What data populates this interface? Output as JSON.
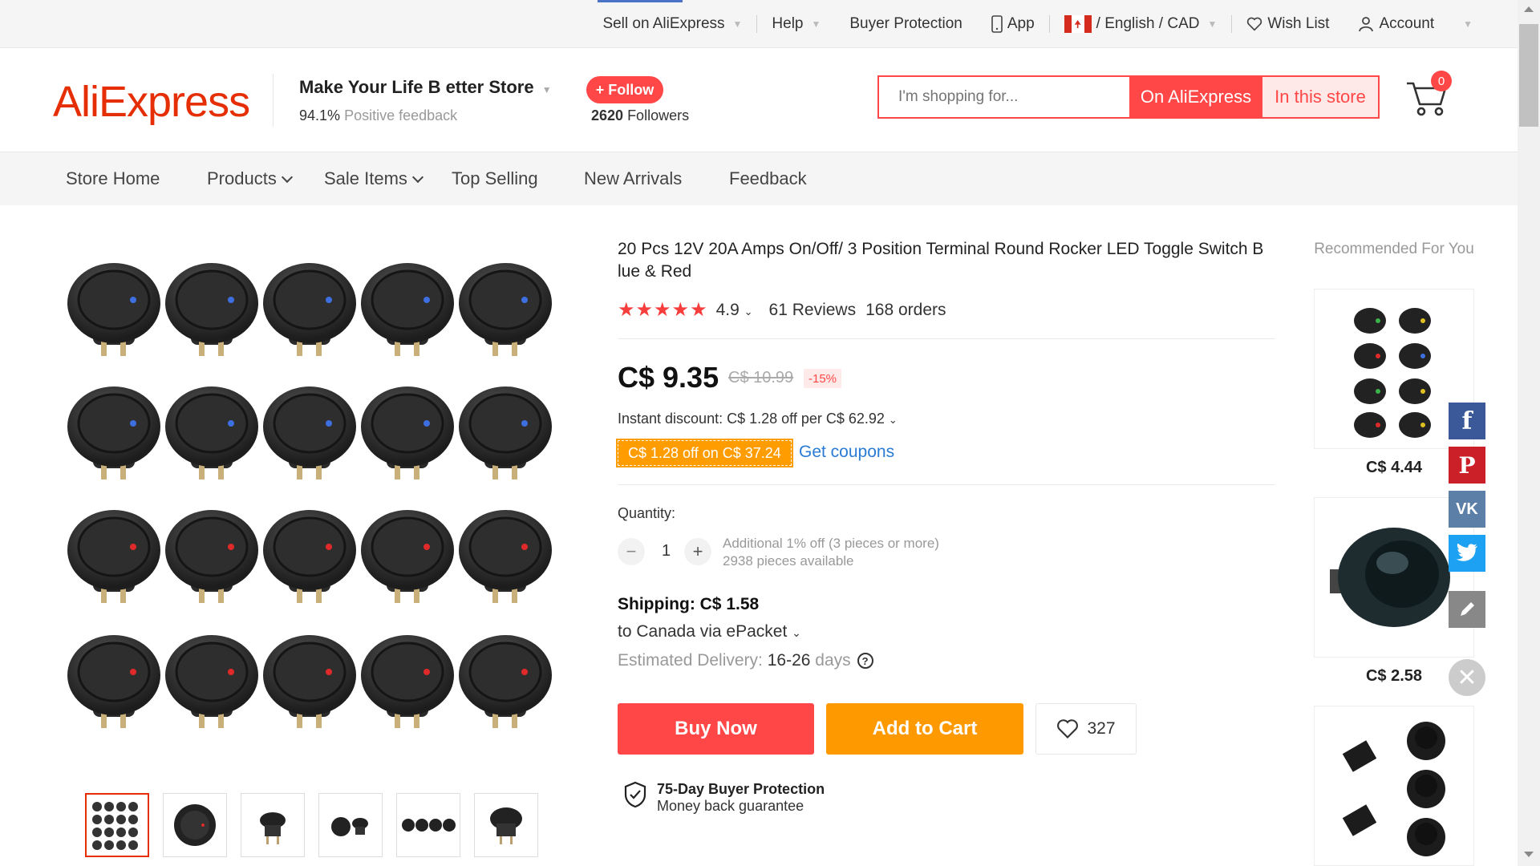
{
  "topbar": {
    "sell": "Sell on AliExpress",
    "help": "Help",
    "buyer_protection": "Buyer Protection",
    "app": "App",
    "locale": "/ English /  CAD",
    "wishlist": "Wish List",
    "account": "Account"
  },
  "header": {
    "logo": "AliExpress",
    "store_name": "Make Your Life B etter Store",
    "feedback_pct": "94.1%",
    "feedback_label": "Positive feedback",
    "follow_label": "+ Follow",
    "followers_count": "2620",
    "followers_label": "Followers",
    "search_placeholder": "I'm shopping for...",
    "search_on": "On AliExpress",
    "search_in": "In this store",
    "cart_count": "0"
  },
  "storenav": {
    "home": "Store Home",
    "products": "Products",
    "sale": "Sale Items",
    "top": "Top Selling",
    "new": "New Arrivals",
    "feedback": "Feedback"
  },
  "product": {
    "title": "20 Pcs 12V 20A Amps On/Off/ 3 Position Terminal Round Rocker LED Toggle Switch B lue & Red",
    "stars": "★★★★★",
    "rating": "4.9",
    "reviews": "61 Reviews",
    "orders": "168 orders",
    "price": "C$ 9.35",
    "old_price": "C$ 10.99",
    "discount": "-15%",
    "instant_discount": "Instant discount: C$ 1.28 off per C$ 62.92",
    "coupon": "C$ 1.28 off on C$ 37.24",
    "get_coupons": "Get coupons",
    "quantity_label": "Quantity:",
    "quantity": "1",
    "qty_note1": "Additional 1% off (3 pieces or more)",
    "qty_note2": "2938 pieces available",
    "shipping": "Shipping: C$ 1.58",
    "ship_to": "to Canada via ePacket",
    "delivery_label": "Estimated Delivery:",
    "delivery_days": "16-26",
    "delivery_unit": "days",
    "buy_now": "Buy Now",
    "add_to_cart": "Add to Cart",
    "wish_count": "327",
    "protect_title": "75-Day Buyer Protection",
    "protect_sub": "Money back guarantee"
  },
  "recommended": {
    "title": "Recommended For You",
    "items": [
      {
        "price": "C$ 4.44"
      },
      {
        "price": "C$ 2.58"
      }
    ]
  },
  "social": [
    "facebook-icon",
    "pinterest-icon",
    "vk-icon",
    "twitter-icon",
    "edit-icon"
  ],
  "colors": {
    "brand": "#e62e04",
    "primary": "#ff4747",
    "orange": "#ff9900",
    "blue": "#2a7bd4"
  }
}
